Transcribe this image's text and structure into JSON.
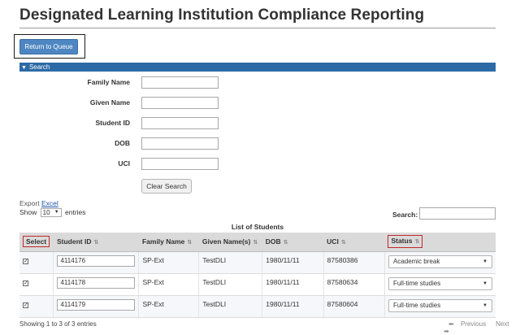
{
  "page": {
    "title": "Designated Learning Institution Compliance Reporting",
    "return_button": "Return to Queue"
  },
  "search_panel": {
    "header": "Search",
    "fields": [
      {
        "label": "Family Name",
        "value": ""
      },
      {
        "label": "Given Name",
        "value": ""
      },
      {
        "label": "Student ID",
        "value": ""
      },
      {
        "label": "DOB",
        "value": ""
      },
      {
        "label": "UCI",
        "value": ""
      }
    ],
    "clear_button": "Clear Search"
  },
  "table_controls": {
    "export_prefix": "Export",
    "export_link": "Excel",
    "show_prefix": "Show",
    "page_size": "10",
    "show_suffix": "entries",
    "search_label": "Search:",
    "search_value": ""
  },
  "table": {
    "caption": "List of Students",
    "columns": [
      "Select",
      "Student ID",
      "Family Name",
      "Given Name(s)",
      "DOB",
      "UCI",
      "Status"
    ],
    "rows": [
      {
        "selected": true,
        "student_id": "4114176",
        "family_name": "SP-Ext",
        "given_names": "TestDLI",
        "dob": "1980/11/11",
        "uci": "87580386",
        "status": "Academic break"
      },
      {
        "selected": true,
        "student_id": "4114178",
        "family_name": "SP-Ext",
        "given_names": "TestDLI",
        "dob": "1980/11/11",
        "uci": "87580634",
        "status": "Full-time studies"
      },
      {
        "selected": true,
        "student_id": "4114179",
        "family_name": "SP-Ext",
        "given_names": "TestDLI",
        "dob": "1980/11/11",
        "uci": "87580604",
        "status": "Full-time studies"
      }
    ]
  },
  "footer": {
    "info": "Showing 1 to 3 of 3 entries",
    "previous": "Previous",
    "next": "Next"
  },
  "colors": {
    "button_blue": "#4e86c2",
    "search_bar_blue": "#2d6aa6",
    "highlight_red": "#c0282d",
    "header_gray": "#dadada"
  }
}
